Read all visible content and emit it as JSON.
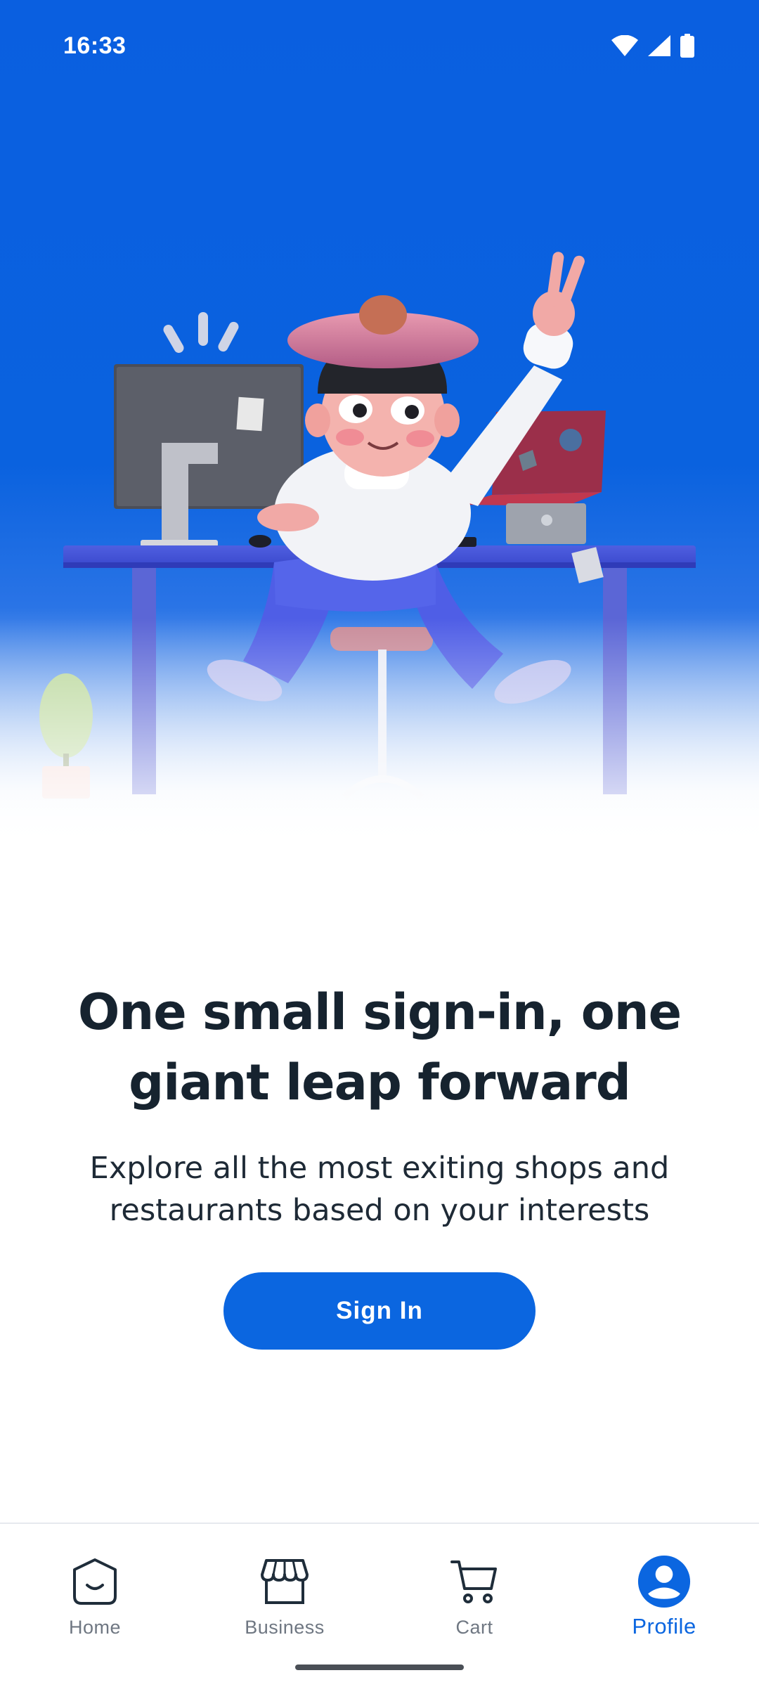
{
  "status_bar": {
    "time": "16:33",
    "icons": [
      "wifi-icon",
      "cellular-signal-icon",
      "battery-icon"
    ]
  },
  "hero": {
    "illustration": "person-at-desk-waving-illustration",
    "colors": {
      "top": "#0a5fe0",
      "bottom": "#ffffff"
    }
  },
  "content": {
    "headline": "One small sign-in, one giant leap forward",
    "subtitle": "Explore all the most exiting shops and restaurants based on your interests",
    "signin_label": "Sign In"
  },
  "bottom_nav": {
    "items": [
      {
        "label": "Home",
        "icon": "home-face-icon",
        "active": false
      },
      {
        "label": "Business",
        "icon": "storefront-icon",
        "active": false
      },
      {
        "label": "Cart",
        "icon": "cart-icon",
        "active": false
      },
      {
        "label": "Profile",
        "icon": "profile-icon",
        "active": true
      }
    ]
  },
  "colors": {
    "accent": "#0b66e0",
    "text_dark": "#16232f",
    "nav_inactive": "#6f7782"
  }
}
